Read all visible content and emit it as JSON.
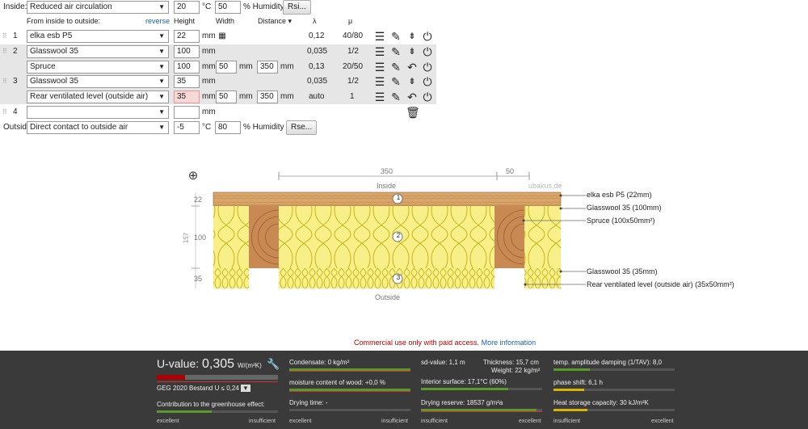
{
  "inside": {
    "label": "Inside:",
    "mode": "Reduced air circulation",
    "temp": "20",
    "temp_unit": "°C",
    "humidity": "50",
    "humidity_unit": "% Humidity",
    "button": "Rsi..."
  },
  "header": {
    "order": "From inside to outside:",
    "reverse": "reverse",
    "height": "Height",
    "width": "Width",
    "distance": "Distance",
    "sort": "▾",
    "lambda": "λ",
    "mu": "μ"
  },
  "layers": [
    {
      "num": "1",
      "material": "elka esb P5",
      "height": "22",
      "unit": "mm",
      "lambda": "0,12",
      "mu": "40/80"
    },
    {
      "num": "2",
      "material": "Glasswool 35",
      "height": "100",
      "unit": "mm",
      "lambda": "0,035",
      "mu": "1/2"
    },
    {
      "material": "Spruce",
      "height": "100",
      "unit": "mm",
      "width": "50",
      "width_unit": "mm",
      "distance": "350",
      "distance_unit": "mm",
      "lambda": "0,13",
      "mu": "20/50"
    },
    {
      "num": "3",
      "material": "Glasswool 35",
      "height": "35",
      "unit": "mm",
      "lambda": "0,035",
      "mu": "1/2"
    },
    {
      "material": "Rear ventilated level (outside air)",
      "height": "35",
      "unit": "mm",
      "width": "50",
      "width_unit": "mm",
      "distance": "350",
      "distance_unit": "mm",
      "lambda": "auto",
      "mu": "1"
    },
    {
      "num": "4",
      "material": "",
      "height": "",
      "unit": "mm"
    }
  ],
  "outside": {
    "label": "Outside",
    "mode": "Direct contact to outside air",
    "temp": "-5",
    "temp_unit": "°C",
    "humidity": "80",
    "humidity_unit": "% Humidity",
    "button": "Rse..."
  },
  "diagram": {
    "dim_top1": "350",
    "dim_top2": "50",
    "inside": "Inside",
    "watermark": "ubakus.de",
    "outside": "Outside",
    "h1": "22",
    "h2": "100",
    "h3": "35",
    "total": "157",
    "mark1": "1",
    "mark2": "2",
    "mark3": "3",
    "labels": [
      "elka esb P5 (22mm)",
      "Glasswool 35 (100mm)",
      "Spruce (100x50mm²)",
      "Glasswool 35 (35mm)",
      "Rear ventilated level (outside air) (35x50mm²)"
    ]
  },
  "notice": {
    "text": "Commercial use only with paid access.",
    "link": "More information"
  },
  "footer": {
    "uvalue_label": "U-value:",
    "uvalue": "0,305",
    "uvalue_unit": "W/(m²K)",
    "geg": "GEG 2020 Bestand U ≤ 0,24",
    "greenhouse": "Contribution to the greenhouse effect:",
    "excellent": "excellent",
    "insufficient": "insufficient",
    "condensate": "Condensate: 0 kg/m²",
    "moisture": "moisture content of wood: +0,0 %",
    "drying": "Drying time: -",
    "sd": "sd-value: 1,1 m",
    "thickness": "Thickness: 15,7 cm",
    "weight": "Weight: 22 kg/m²",
    "interior": "Interior surface: 17,1°C (60%)",
    "reserve": "Drying reserve: 18537 g/m²a",
    "damping": "temp. amplitude damping (1/TAV): 8,0",
    "phase": "phase shift: 6,1 h",
    "heat": "Heat storage capacity: 30 kJ/m²K",
    "uvalue_fill": 0.23,
    "greenhouse_fill": 0.45,
    "interior_fill": 0.72,
    "reserve_fill": 0.95,
    "damping_fill": 0.3,
    "phase_fill": 0.25,
    "heat_fill": 0.28
  }
}
